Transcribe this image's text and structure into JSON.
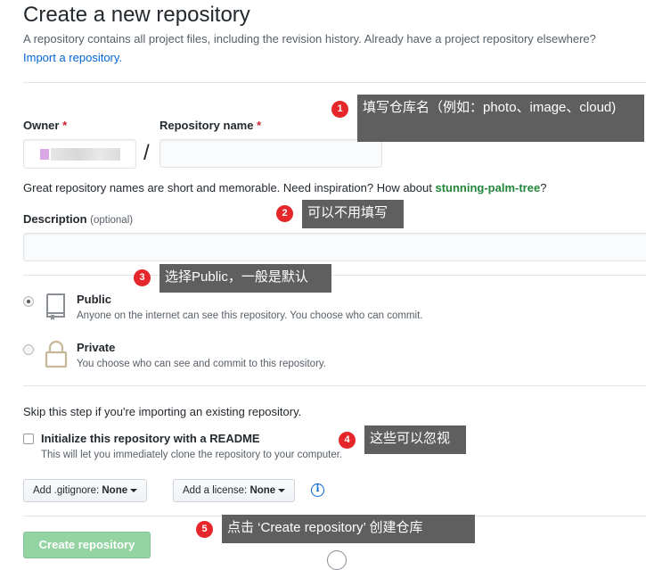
{
  "page": {
    "title": "Create a new repository",
    "subtitle": "A repository contains all project files, including the revision history. Already have a project repository elsewhere?",
    "import_link": "Import a repository."
  },
  "owner": {
    "label": "Owner",
    "required_mark": "*"
  },
  "repo_name": {
    "label": "Repository name",
    "required_mark": "*",
    "separator": "/",
    "value": ""
  },
  "name_hint": {
    "text": "Great repository names are short and memorable. Need inspiration? How about ",
    "suggestion": "stunning-palm-tree",
    "end": "?"
  },
  "description": {
    "label": "Description",
    "optional": "(optional)",
    "value": ""
  },
  "visibility": {
    "public": {
      "label": "Public",
      "desc": "Anyone on the internet can see this repository. You choose who can commit.",
      "checked": true
    },
    "private": {
      "label": "Private",
      "desc": "You choose who can see and commit to this repository.",
      "checked": false
    }
  },
  "init": {
    "skip_text": "Skip this step if you're importing an existing repository.",
    "readme_label": "Initialize this repository with a README",
    "readme_desc": "This will let you immediately clone the repository to your computer.",
    "readme_checked": false
  },
  "gitignore": {
    "prefix": "Add .gitignore:",
    "value": "None"
  },
  "license": {
    "prefix": "Add a license:",
    "value": "None"
  },
  "info_icon": "i",
  "create_button": "Create repository",
  "annotations": [
    {
      "number": "1",
      "text": "填写仓库名（例如：photo、image、cloud)"
    },
    {
      "number": "2",
      "text": "可以不用填写"
    },
    {
      "number": "3",
      "text": "选择Public，一般是默认"
    },
    {
      "number": "4",
      "text": "这些可以忽视"
    },
    {
      "number": "5",
      "text": "点击 ‘Create repository’ 创建仓库"
    }
  ],
  "colors": {
    "link": "#0366d6",
    "required": "#cb2431",
    "suggestion": "#22863a",
    "create_button": "#94d3a2",
    "badge": "#e5262a",
    "callout": "#5f5f5f"
  }
}
